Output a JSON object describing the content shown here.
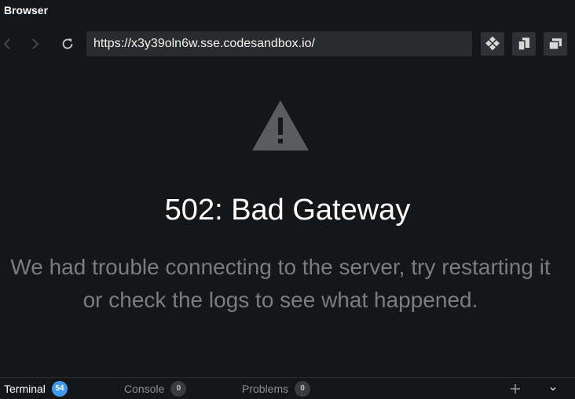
{
  "panel": {
    "title": "Browser"
  },
  "navbar": {
    "url": "https://x3y39oln6w.sse.codesandbox.io/",
    "icons": {
      "back": "chevron-left-icon",
      "forward": "chevron-right-icon",
      "refresh": "refresh-icon",
      "devtools": "devtools-icon",
      "copy": "copy-icon",
      "open_new": "open-in-new-window-icon"
    }
  },
  "error": {
    "icon": "warning-triangle-icon",
    "title": "502: Bad Gateway",
    "message_line1": "We had trouble connecting to the server, try restarting it",
    "message_line2": "or check the logs to see what happened."
  },
  "bottom_tabs": [
    {
      "label": "Terminal",
      "count": "54",
      "active": true
    },
    {
      "label": "Console",
      "count": "0",
      "active": false
    },
    {
      "label": "Problems",
      "count": "0",
      "active": false
    }
  ],
  "bottom_actions": {
    "add": "plus-icon",
    "collapse": "chevron-down-icon"
  },
  "colors": {
    "background": "#151618",
    "url_bg": "#2a2b2d",
    "warning_icon": "#5b5c5e",
    "message_text": "#7b7c7f",
    "badge_active": "#3f9bf0"
  }
}
